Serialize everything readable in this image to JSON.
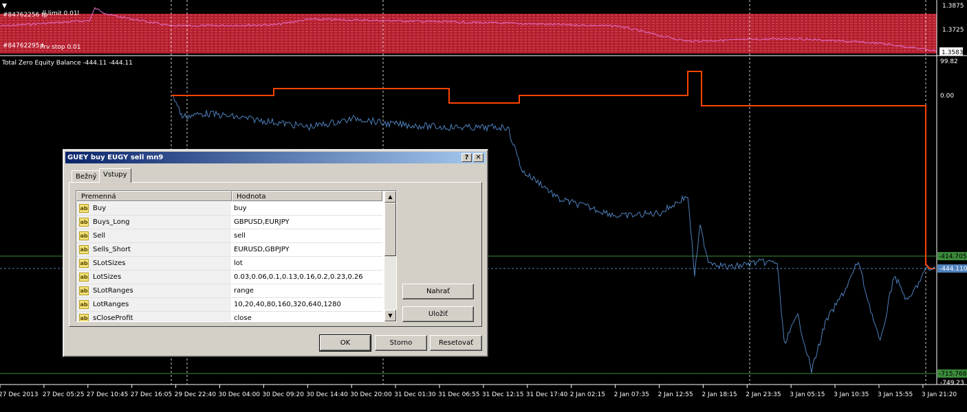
{
  "chart": {
    "orders": [
      {
        "label": "#84762256 tp",
        "tag": "ll limit 0.01l"
      },
      {
        "label": "#84762295 t",
        "tag": "Prv stop 0.01"
      }
    ],
    "price_axis": [
      "1.3875",
      "1.3725",
      "1.3583"
    ],
    "indicator_title": "Total Zero Equity Balance -444.11 -444.11",
    "indicator_axis": [
      "99.82",
      "0.00",
      "-414.705",
      "-444.110",
      "-715.768",
      "-749.23"
    ],
    "time_axis": [
      "27 Dec 2013",
      "27 Dec 05:25",
      "27 Dec 10:45",
      "27 Dec 16:05",
      "29 Dec 22:40",
      "30 Dec 04:00",
      "30 Dec 09:20",
      "30 Dec 14:40",
      "30 Dec 20:00",
      "31 Dec 01:30",
      "31 Dec 06:55",
      "31 Dec 12:15",
      "31 Dec 17:40",
      "2 Jan 02:15",
      "2 Jan 07:35",
      "2 Jan 12:55",
      "2 Jan 18:15",
      "2 Jan 23:35",
      "3 Jan 05:15",
      "3 Jan 10:35",
      "3 Jan 15:55",
      "3 Jan 21:20"
    ],
    "colors": {
      "equity_line": "#4f81bd",
      "balance_line": "#ff4500",
      "level_line": "#3a8a3a",
      "grid": "#ffffff",
      "band": "#b01e2e"
    }
  },
  "dialog": {
    "title": "GUEY buy EUGY sell mn9",
    "help_button": "?",
    "close_button": "✕",
    "tabs": [
      "Bežný",
      "Vstupy"
    ],
    "active_tab": "Vstupy",
    "columns": [
      "Premenná",
      "Hodnota"
    ],
    "rows": [
      {
        "name": "Buy",
        "value": "buy"
      },
      {
        "name": "Buys_Long",
        "value": "GBPUSD,EURJPY"
      },
      {
        "name": "Sell",
        "value": "sell"
      },
      {
        "name": "Sells_Short",
        "value": "EURUSD,GBPJPY"
      },
      {
        "name": "SLotSizes",
        "value": "lot"
      },
      {
        "name": "LotSizes",
        "value": "0.03,0.06,0.1,0.13,0.16,0.2,0.23,0.26"
      },
      {
        "name": "SLotRanges",
        "value": "range"
      },
      {
        "name": "LotRanges",
        "value": "10,20,40,80,160,320,640,1280"
      },
      {
        "name": "sCloseProfit",
        "value": "close"
      }
    ],
    "icon_label": "ab",
    "load_button": "Nahrať",
    "save_button": "Uložiť",
    "ok_button": "OK",
    "cancel_button": "Storno",
    "reset_button": "Resetovať"
  }
}
